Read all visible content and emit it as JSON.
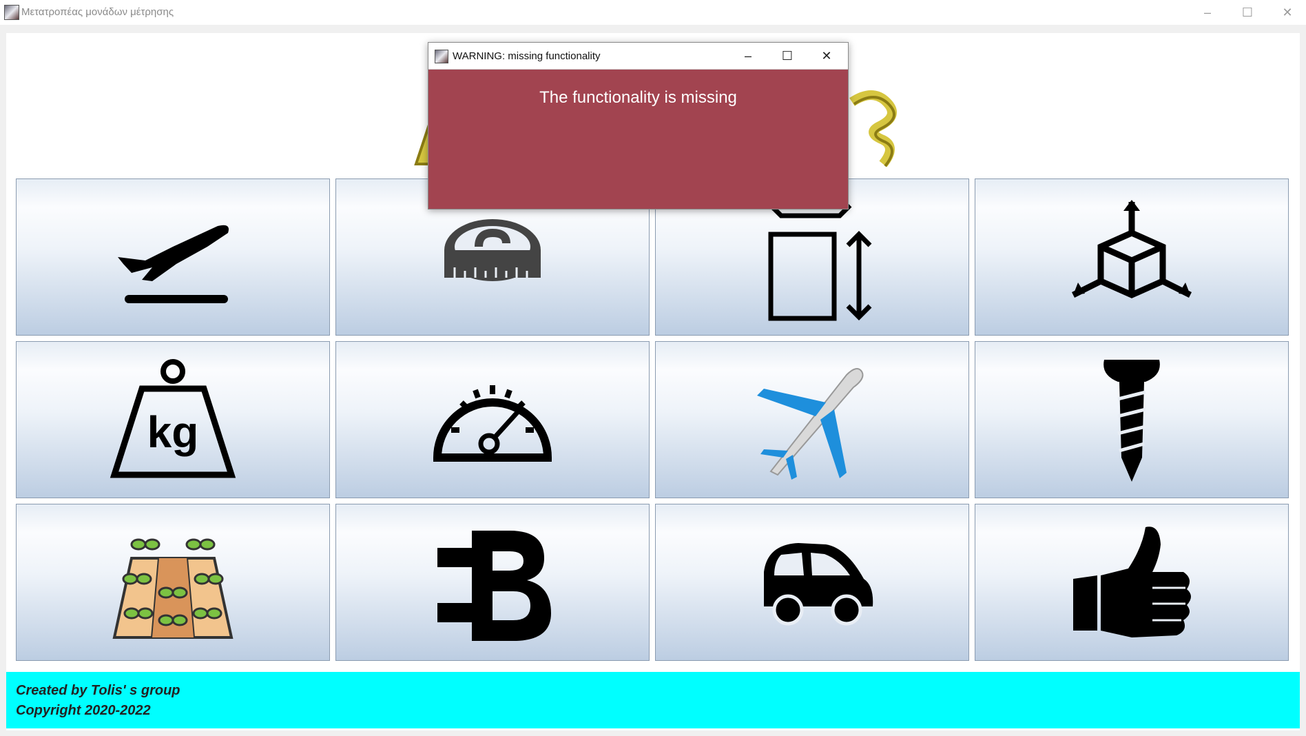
{
  "window": {
    "title": "Μετατροπέας μονάδων μέτρησης",
    "minimize_glyph": "–",
    "maximize_glyph": "☐",
    "close_glyph": "✕"
  },
  "tiles": [
    {
      "name": "airplane-takeoff-icon",
      "label": "Distance"
    },
    {
      "name": "measuring-tape-icon",
      "label": "Length"
    },
    {
      "name": "area-square-icon",
      "label": "Area"
    },
    {
      "name": "volume-cube-icon",
      "label": "Volume"
    },
    {
      "name": "weight-kg-icon",
      "label": "Weight"
    },
    {
      "name": "speedometer-icon",
      "label": "Speed"
    },
    {
      "name": "airplane-icon",
      "label": "Aviation"
    },
    {
      "name": "screw-icon",
      "label": "Screws"
    },
    {
      "name": "farmland-icon",
      "label": "Land"
    },
    {
      "name": "currency-b-icon",
      "label": "Currency"
    },
    {
      "name": "car-icon",
      "label": "Car"
    },
    {
      "name": "thumbs-up-icon",
      "label": "Like"
    }
  ],
  "tile_weight_text": "kg",
  "footer": {
    "line1": "Created by Tolis' s group",
    "line2": "Copyright 2020-2022"
  },
  "dialog": {
    "title": "WARNING: missing functionality",
    "message": "The functionality is missing",
    "minimize_glyph": "–",
    "maximize_glyph": "☐",
    "close_glyph": "✕"
  },
  "colors": {
    "footer_bg": "#00ffff",
    "dialog_bg": "#a24450",
    "logo_gold": "#d6c640"
  }
}
